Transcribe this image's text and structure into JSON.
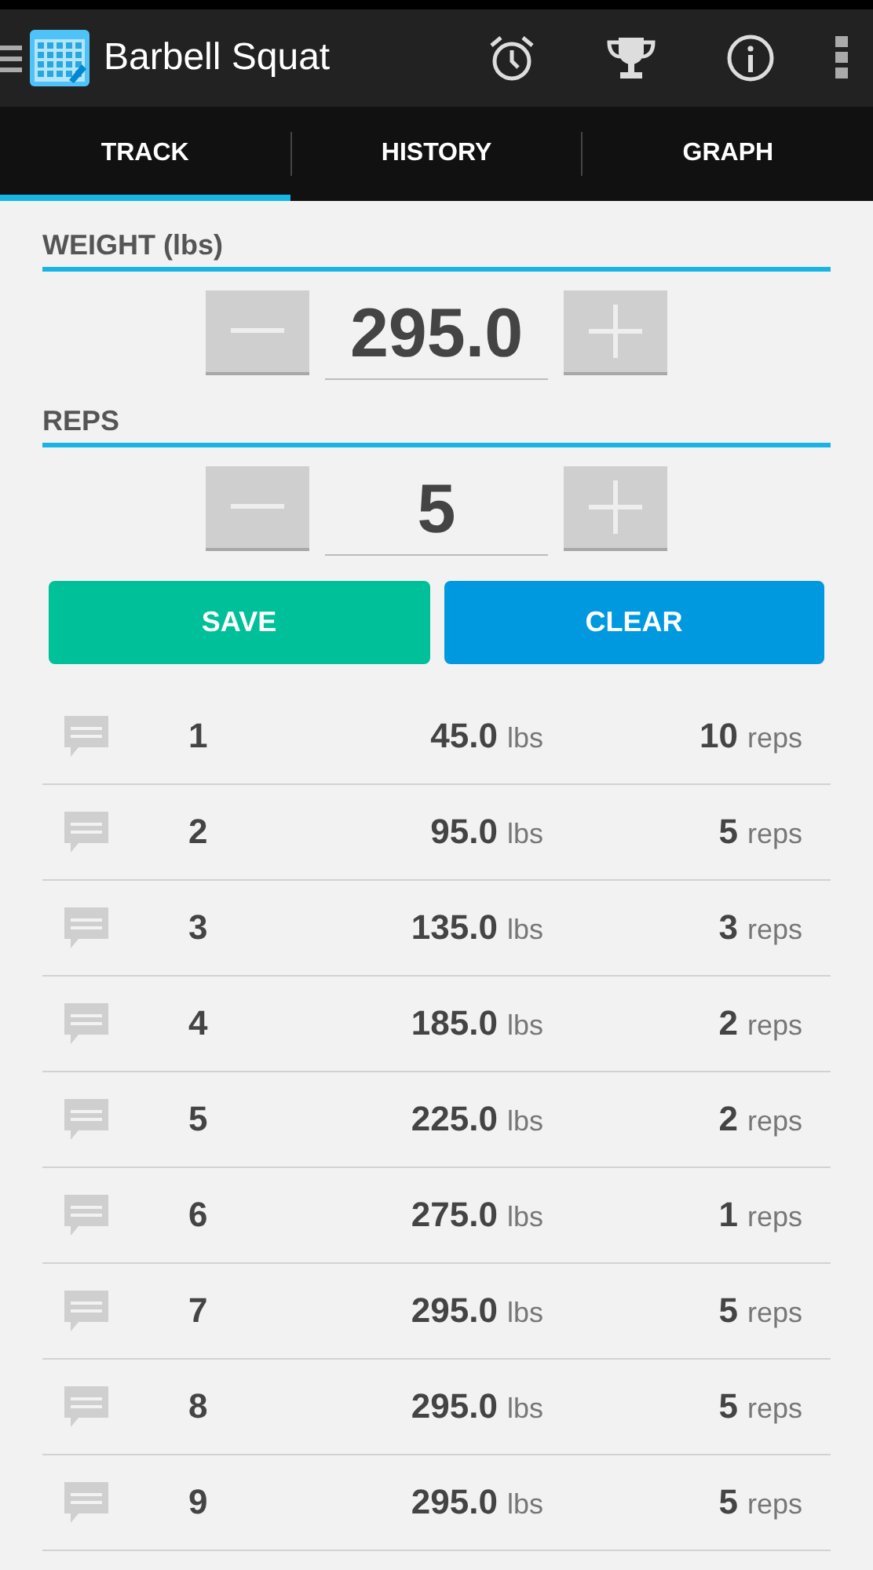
{
  "action_bar": {
    "title": "Barbell Squat"
  },
  "tabs": [
    {
      "label": "TRACK",
      "selected": true
    },
    {
      "label": "HISTORY",
      "selected": false
    },
    {
      "label": "GRAPH",
      "selected": false
    }
  ],
  "steppers": [
    {
      "label": "WEIGHT (lbs)",
      "value": "295.0"
    },
    {
      "label": "REPS",
      "value": "5"
    }
  ],
  "buttons": [
    {
      "kind": "save",
      "label": "SAVE"
    },
    {
      "kind": "clear",
      "label": "CLEAR"
    }
  ],
  "sets": [
    {
      "number": "1",
      "weight": "45.0",
      "weight_unit": "lbs",
      "reps": "10",
      "reps_unit": "reps"
    },
    {
      "number": "2",
      "weight": "95.0",
      "weight_unit": "lbs",
      "reps": "5",
      "reps_unit": "reps"
    },
    {
      "number": "3",
      "weight": "135.0",
      "weight_unit": "lbs",
      "reps": "3",
      "reps_unit": "reps"
    },
    {
      "number": "4",
      "weight": "185.0",
      "weight_unit": "lbs",
      "reps": "2",
      "reps_unit": "reps"
    },
    {
      "number": "5",
      "weight": "225.0",
      "weight_unit": "lbs",
      "reps": "2",
      "reps_unit": "reps"
    },
    {
      "number": "6",
      "weight": "275.0",
      "weight_unit": "lbs",
      "reps": "1",
      "reps_unit": "reps"
    },
    {
      "number": "7",
      "weight": "295.0",
      "weight_unit": "lbs",
      "reps": "5",
      "reps_unit": "reps"
    },
    {
      "number": "8",
      "weight": "295.0",
      "weight_unit": "lbs",
      "reps": "5",
      "reps_unit": "reps"
    },
    {
      "number": "9",
      "weight": "295.0",
      "weight_unit": "lbs",
      "reps": "5",
      "reps_unit": "reps"
    }
  ]
}
